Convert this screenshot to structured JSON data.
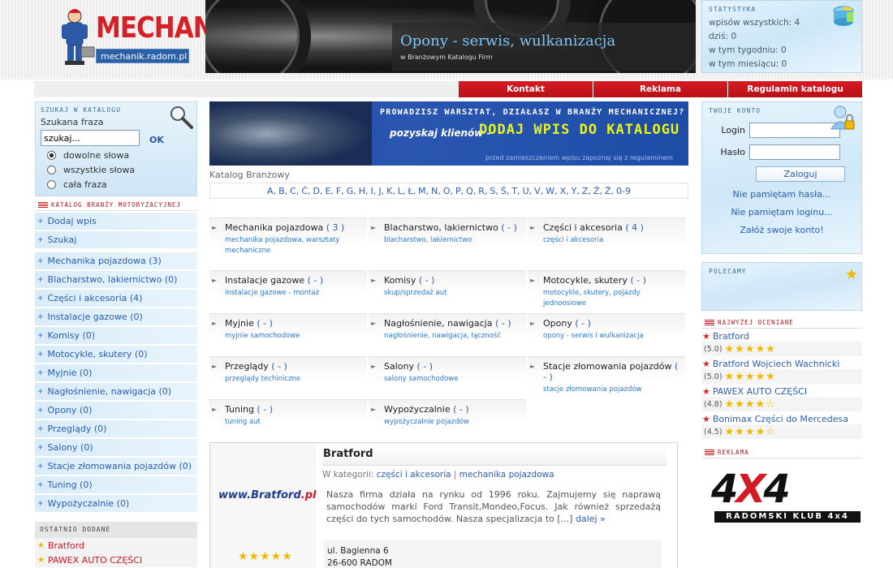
{
  "header": {
    "logo_text": "MECHANIK",
    "logo_url": "mechanik.radom.pl",
    "banner_title": "Opony - serwis, wulkanizacja",
    "banner_subtitle": "w Branżowym Katalogu Firm"
  },
  "stats": {
    "title": "STATYSTYKA",
    "lines": [
      "wpisów wszystkich: 4",
      "dziś: 0",
      "w tym tygodniu: 0",
      "w tym miesiącu: 0"
    ]
  },
  "nav": [
    "Kontakt",
    "Reklama",
    "Regulamin katalogu"
  ],
  "search": {
    "title": "SZUKAJ W KATALOGU",
    "label": "Szukana fraza",
    "placeholder": "szukaj...",
    "value": "szukaj...",
    "ok": "OK",
    "options": [
      "dowolne słowa",
      "wszystkie słowa",
      "cała fraza"
    ],
    "selected_index": 0
  },
  "catalog_menu": {
    "title": "KATALOG BRANŻY MOTORYZACYJNEJ",
    "top_items": [
      "Dodaj wpis",
      "Szukaj"
    ],
    "items": [
      "Mechanika pojazdowa (3)",
      "Blacharstwo, lakiernictwo (0)",
      "Części i akcesoria (4)",
      "Instalacje gazowe (0)",
      "Komisy (0)",
      "Motocykle, skutery (0)",
      "Myjnie (0)",
      "Nagłośnienie, nawigacja (0)",
      "Opony (0)",
      "Przeglądy (0)",
      "Salony (0)",
      "Stacje złomowania pojazdów (0)",
      "Tuning (0)",
      "Wypożyczalnie (0)"
    ]
  },
  "recent": {
    "title": "OSTATNIO DODANE",
    "items": [
      "Bratford",
      "PAWEX AUTO CZĘŚCI"
    ]
  },
  "promo": {
    "line1": "PROWADZISZ WARSZTAT, DZIAŁASZ W BRANŻY MECHANICZNEJ?",
    "lead": "pozyskaj klienów -",
    "cta": "DODAJ WPIS DO KATALOGU",
    "note": "przed zamieszczeniem wpisu zapoznaj się z regulaminem"
  },
  "breadcrumb": "Katalog Branżowy",
  "alphabet": [
    "A,",
    "B,",
    "C,",
    "Ć,",
    "D,",
    "E,",
    "F,",
    "G,",
    "H,",
    "I,",
    "J,",
    "K,",
    "L,",
    "Ł,",
    "M,",
    "N,",
    "O,",
    "P,",
    "Q,",
    "R,",
    "S,",
    "Ś,",
    "T,",
    "U,",
    "V,",
    "W,",
    "X,",
    "Y,",
    "Z,",
    "Ż,",
    "Ź,",
    "0-9"
  ],
  "categories": [
    {
      "name": "Mechanika pojazdowa",
      "count": "( 3 )",
      "tags": "mechanika pojazdowa, warsztaty mechaniczne"
    },
    {
      "name": "Blacharstwo, lakiernictwo",
      "count": "( - )",
      "tags": "blacharstwo, lakiernictwo"
    },
    {
      "name": "Części i akcesoria",
      "count": "( 4 )",
      "tags": "części i akcesoria"
    },
    {
      "name": "Instalacje gazowe",
      "count": "( - )",
      "tags": "instalacje gazowe - montaż"
    },
    {
      "name": "Komisy",
      "count": "( - )",
      "tags": "skup/sprzedaż aut"
    },
    {
      "name": "Motocykle, skutery",
      "count": "( - )",
      "tags": "motocykle, skutery, pojazdy jednoosiowe"
    },
    {
      "name": "Myjnie",
      "count": "( - )",
      "tags": "myjnie samochodowe"
    },
    {
      "name": "Nagłośnienie, nawigacja",
      "count": "( - )",
      "tags": "nagłośnienie, nawigacja, łączność"
    },
    {
      "name": "Opony",
      "count": "( - )",
      "tags": "opony - serwis i wulkanizacja"
    },
    {
      "name": "Przeglądy",
      "count": "( - )",
      "tags": "przeglądy techiniczne"
    },
    {
      "name": "Salony",
      "count": "( - )",
      "tags": "salony samochodowe"
    },
    {
      "name": "Stacje złomowania pojazdów",
      "count": "( - )",
      "tags": "stacje złomowania pojazdów"
    },
    {
      "name": "Tuning",
      "count": "( - )",
      "tags": "tuning aut"
    },
    {
      "name": "Wypożyczalnie",
      "count": "( - )",
      "tags": "wypożyczalnie pojazdów"
    }
  ],
  "listing": {
    "logo_text_blue": "www.Bra",
    "logo_text_mid": "tford",
    "logo_text_red": ".pl",
    "title": "Bratford",
    "category_prefix": "W kategorii:",
    "category_links": [
      "części i akcesoria",
      "mechanika pojazdowa"
    ],
    "description": "Nasza firma działa na rynku od 1996 roku. Zajmujemy się naprawą samochodów marki Ford Transit,Mondeo,Focus. Jak również sprzedażą części do tych samochodów. Nasza specjalizacja to [...]",
    "more": "dalej »",
    "address_line1": "ul. Bagienna 6",
    "address_line2": "26-600 RADOM",
    "rating": 5
  },
  "account": {
    "title": "TWOJE KONTO",
    "login_label": "Login",
    "password_label": "Hasło",
    "login_button": "Zaloguj",
    "links": [
      "Nie pamiętam hasła...",
      "Nie pamiętam loginu...",
      "Załóż swoje konto!"
    ]
  },
  "recommended": {
    "title": "POLECAMY"
  },
  "top_rated": {
    "title": "NAJWYŻEJ OCENIANE",
    "items": [
      {
        "name": "Bratford",
        "score": "(5.0)",
        "rating": 5
      },
      {
        "name": "Bratford Wojciech Wachnicki",
        "score": "(5.0)",
        "rating": 5
      },
      {
        "name": "PAWEX AUTO CZĘŚCI",
        "score": "(4.8)",
        "rating": 4.8
      },
      {
        "name": "Bonimax Części do Mercedesa",
        "score": "(4.5)",
        "rating": 4.5
      }
    ]
  },
  "ad": {
    "title": "REKLAMA",
    "big": "4X4",
    "club": "RADOMSKI KLUB 4x4"
  },
  "colors": {
    "brand_red": "#d81f26",
    "link_blue": "#2a5db0",
    "panel_blue": "#cfe6f6",
    "star_yellow": "#f1b800"
  }
}
